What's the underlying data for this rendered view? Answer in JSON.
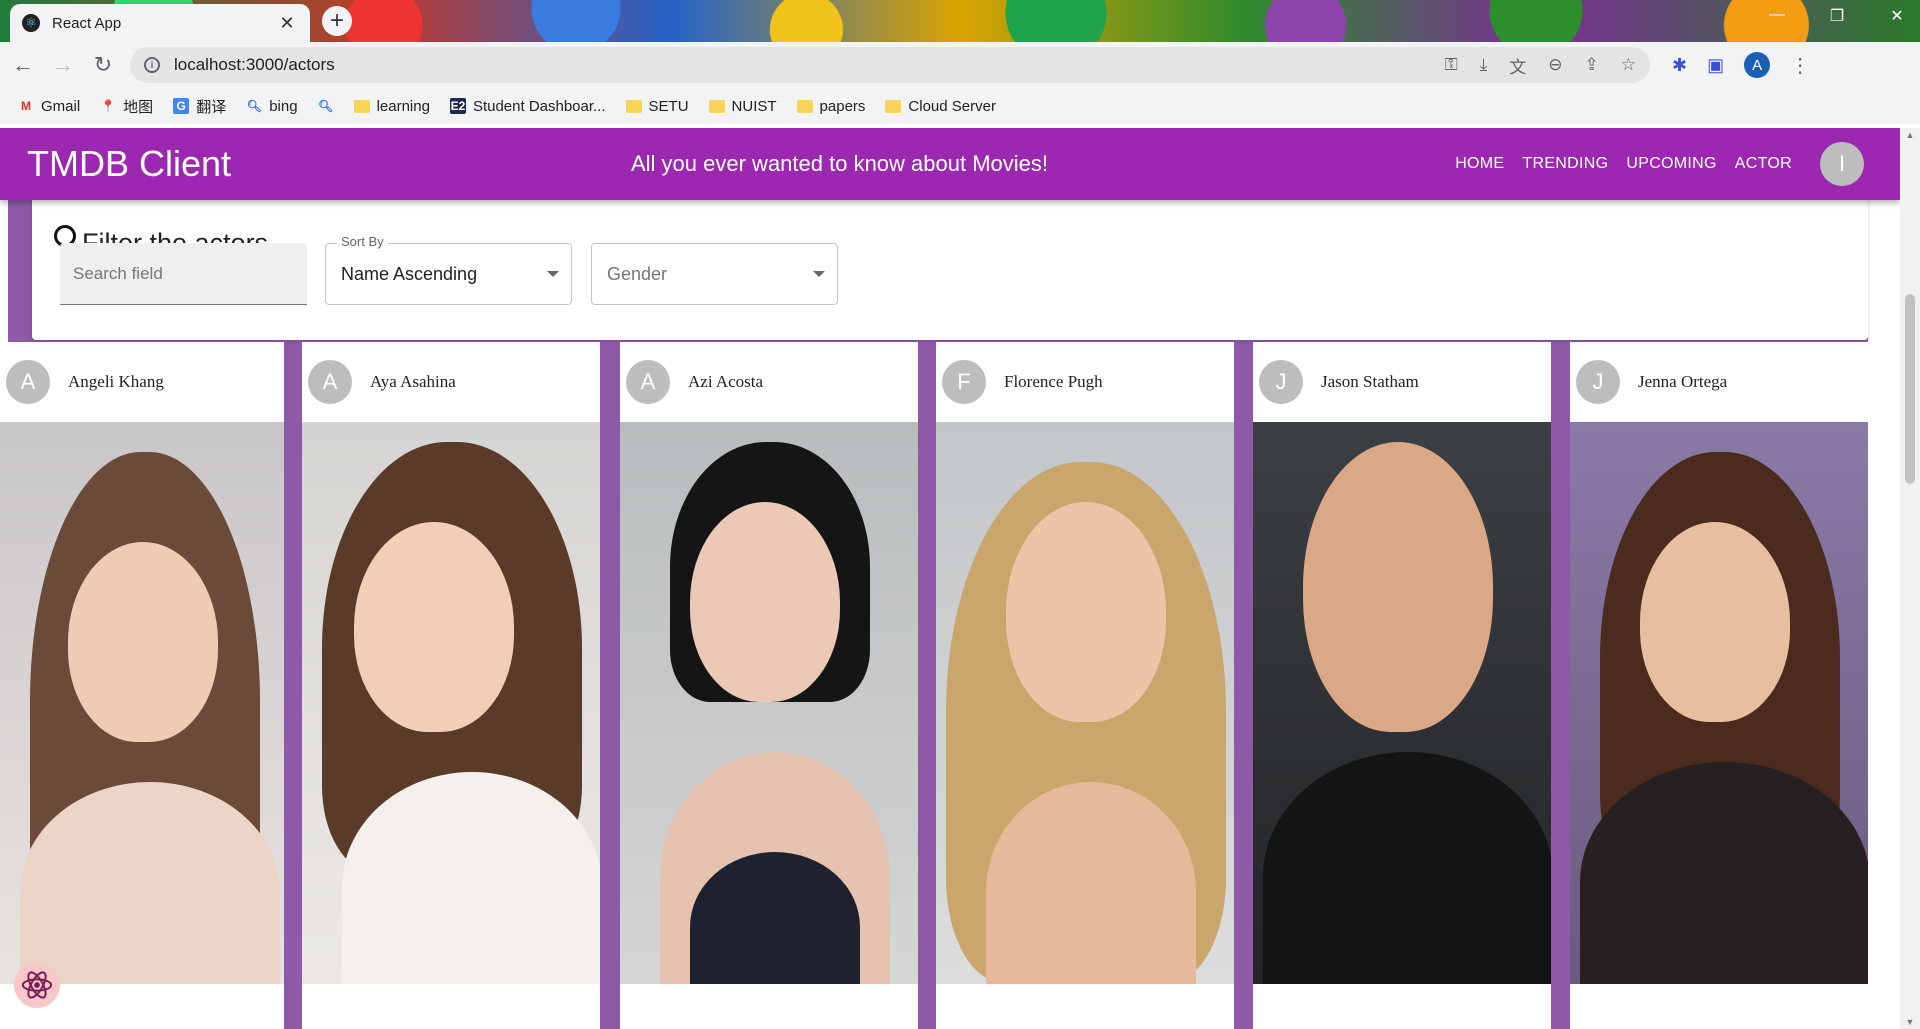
{
  "browser": {
    "tab_title": "React App",
    "tab_close": "✕",
    "new_tab": "+",
    "url": "localhost:3000/actors",
    "profile_initial": "A",
    "bookmarks": [
      {
        "label": "Gmail",
        "icon": "gmail-icon"
      },
      {
        "label": "地图",
        "icon": "maps-icon"
      },
      {
        "label": "翻译",
        "icon": "translate-icon"
      },
      {
        "label": "bing",
        "icon": "search-icon"
      },
      {
        "label": "",
        "icon": "search-icon"
      },
      {
        "label": "learning",
        "icon": "folder-icon"
      },
      {
        "label": "Student Dashboar...",
        "icon": "e2-icon"
      },
      {
        "label": "SETU",
        "icon": "folder-icon"
      },
      {
        "label": "NUIST",
        "icon": "folder-icon"
      },
      {
        "label": "papers",
        "icon": "folder-icon"
      },
      {
        "label": "Cloud Server",
        "icon": "folder-icon"
      }
    ]
  },
  "appbar": {
    "brand": "TMDB Client",
    "tagline": "All you ever wanted to know about Movies!",
    "menu": [
      "HOME",
      "TRENDING",
      "UPCOMING",
      "ACTOR"
    ],
    "user_initial": "I",
    "color": "#9c27b0"
  },
  "filter": {
    "title": "Filter the actors.",
    "search_placeholder": "Search field",
    "sort_label": "Sort By",
    "sort_value": "Name Ascending",
    "gender_placeholder": "Gender"
  },
  "actors": [
    {
      "initial": "A",
      "name": "Angeli Khang"
    },
    {
      "initial": "A",
      "name": "Aya Asahina"
    },
    {
      "initial": "A",
      "name": "Azi Acosta"
    },
    {
      "initial": "F",
      "name": "Florence Pugh"
    },
    {
      "initial": "J",
      "name": "Jason Statham"
    },
    {
      "initial": "J",
      "name": "Jenna Ortega"
    }
  ],
  "accent_purple": "#8e5aa8"
}
